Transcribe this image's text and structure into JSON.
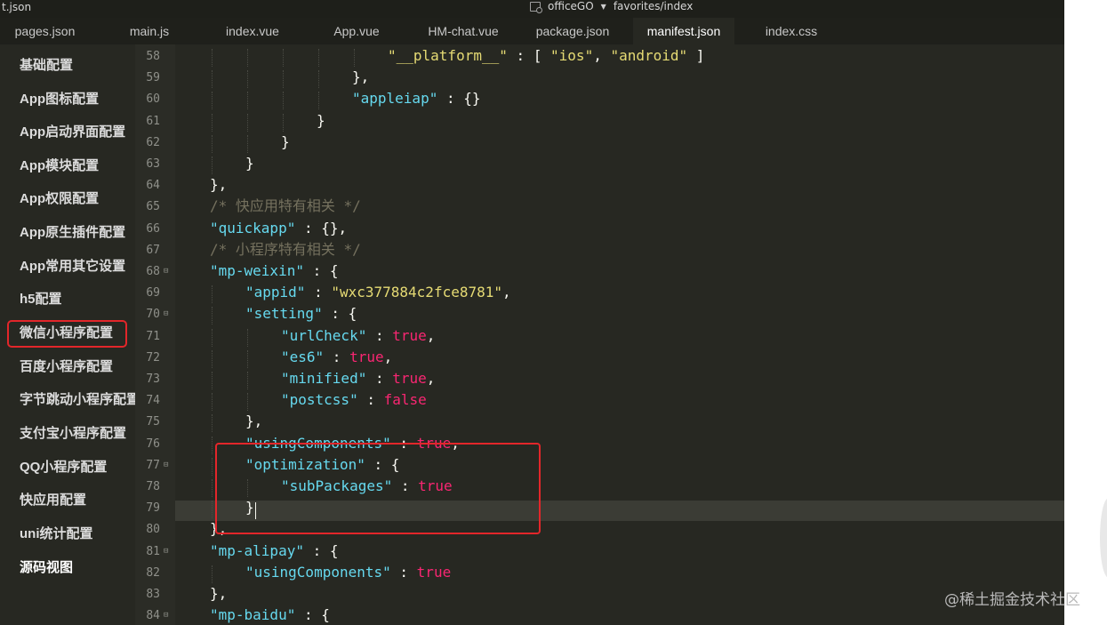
{
  "topbar": {
    "file_name": "t.json",
    "project": "officeGO",
    "path": "favorites/index"
  },
  "tabs": [
    {
      "label": "pages.json"
    },
    {
      "label": "main.js"
    },
    {
      "label": "index.vue"
    },
    {
      "label": "App.vue"
    },
    {
      "label": "HM-chat.vue"
    },
    {
      "label": "package.json"
    },
    {
      "label": "manifest.json",
      "active": true
    },
    {
      "label": "index.css"
    }
  ],
  "sidebar": {
    "items": [
      {
        "label": "基础配置"
      },
      {
        "label": "App图标配置"
      },
      {
        "label": "App启动界面配置"
      },
      {
        "label": "App模块配置"
      },
      {
        "label": "App权限配置"
      },
      {
        "label": "App原生插件配置"
      },
      {
        "label": "App常用其它设置"
      },
      {
        "label": "h5配置"
      },
      {
        "label": "微信小程序配置",
        "highlighted": true
      },
      {
        "label": "百度小程序配置"
      },
      {
        "label": "字节跳动小程序配置"
      },
      {
        "label": "支付宝小程序配置"
      },
      {
        "label": "QQ小程序配置"
      },
      {
        "label": "快应用配置"
      },
      {
        "label": "uni统计配置"
      },
      {
        "label": "源码视图"
      }
    ]
  },
  "code": {
    "lines": [
      {
        "n": "58",
        "fold": false,
        "t": [
          [
            "s",
            "\"__platform__\""
          ],
          [
            "p",
            " : [ "
          ],
          [
            "s",
            "\"ios\""
          ],
          [
            "p",
            ", "
          ],
          [
            "s",
            "\"android\""
          ],
          [
            "p",
            " ]"
          ]
        ],
        "indent": 6
      },
      {
        "n": "59",
        "fold": false,
        "t": [
          [
            "p",
            "},"
          ]
        ],
        "indent": 5
      },
      {
        "n": "60",
        "fold": false,
        "t": [
          [
            "k",
            "\"appleiap\""
          ],
          [
            "p",
            " : {}"
          ]
        ],
        "indent": 5
      },
      {
        "n": "61",
        "fold": false,
        "t": [
          [
            "p",
            "}"
          ]
        ],
        "indent": 4
      },
      {
        "n": "62",
        "fold": false,
        "t": [
          [
            "p",
            "}"
          ]
        ],
        "indent": 3
      },
      {
        "n": "63",
        "fold": false,
        "t": [
          [
            "p",
            "}"
          ]
        ],
        "indent": 2
      },
      {
        "n": "64",
        "fold": false,
        "t": [
          [
            "p",
            "},"
          ]
        ],
        "indent": 1
      },
      {
        "n": "65",
        "fold": false,
        "t": [
          [
            "c",
            "/* 快应用特有相关 */"
          ]
        ],
        "indent": 1
      },
      {
        "n": "66",
        "fold": false,
        "t": [
          [
            "k",
            "\"quickapp\""
          ],
          [
            "p",
            " : {},"
          ]
        ],
        "indent": 1
      },
      {
        "n": "67",
        "fold": false,
        "t": [
          [
            "c",
            "/* 小程序特有相关 */"
          ]
        ],
        "indent": 1
      },
      {
        "n": "68",
        "fold": true,
        "t": [
          [
            "k",
            "\"mp-weixin\""
          ],
          [
            "p",
            " : {"
          ]
        ],
        "indent": 1
      },
      {
        "n": "69",
        "fold": false,
        "t": [
          [
            "k",
            "\"appid\""
          ],
          [
            "p",
            " : "
          ],
          [
            "s",
            "\"wxc377884c2fce8781\""
          ],
          [
            "p",
            ","
          ]
        ],
        "indent": 2
      },
      {
        "n": "70",
        "fold": true,
        "t": [
          [
            "k",
            "\"setting\""
          ],
          [
            "p",
            " : {"
          ]
        ],
        "indent": 2
      },
      {
        "n": "71",
        "fold": false,
        "t": [
          [
            "k",
            "\"urlCheck\""
          ],
          [
            "p",
            " : "
          ],
          [
            "b",
            "true"
          ],
          [
            "p",
            ","
          ]
        ],
        "indent": 3
      },
      {
        "n": "72",
        "fold": false,
        "t": [
          [
            "k",
            "\"es6\""
          ],
          [
            "p",
            " : "
          ],
          [
            "b",
            "true"
          ],
          [
            "p",
            ","
          ]
        ],
        "indent": 3
      },
      {
        "n": "73",
        "fold": false,
        "t": [
          [
            "k",
            "\"minified\""
          ],
          [
            "p",
            " : "
          ],
          [
            "b",
            "true"
          ],
          [
            "p",
            ","
          ]
        ],
        "indent": 3
      },
      {
        "n": "74",
        "fold": false,
        "t": [
          [
            "k",
            "\"postcss\""
          ],
          [
            "p",
            " : "
          ],
          [
            "b",
            "false"
          ]
        ],
        "indent": 3
      },
      {
        "n": "75",
        "fold": false,
        "t": [
          [
            "p",
            "},"
          ]
        ],
        "indent": 2
      },
      {
        "n": "76",
        "fold": false,
        "t": [
          [
            "k",
            "\"usingComponents\""
          ],
          [
            "p",
            " : "
          ],
          [
            "b",
            "true"
          ],
          [
            "p",
            ","
          ]
        ],
        "indent": 2
      },
      {
        "n": "77",
        "fold": true,
        "t": [
          [
            "k",
            "\"optimization\""
          ],
          [
            "p",
            " : {"
          ]
        ],
        "indent": 2
      },
      {
        "n": "78",
        "fold": false,
        "t": [
          [
            "k",
            "\"subPackages\""
          ],
          [
            "p",
            " : "
          ],
          [
            "b",
            "true"
          ]
        ],
        "indent": 3
      },
      {
        "n": "79",
        "fold": false,
        "t": [
          [
            "p",
            "}"
          ]
        ],
        "indent": 2
      },
      {
        "n": "80",
        "fold": false,
        "t": [
          [
            "p",
            "},"
          ]
        ],
        "indent": 1
      },
      {
        "n": "81",
        "fold": true,
        "t": [
          [
            "k",
            "\"mp-alipay\""
          ],
          [
            "p",
            " : {"
          ]
        ],
        "indent": 1
      },
      {
        "n": "82",
        "fold": false,
        "t": [
          [
            "k",
            "\"usingComponents\""
          ],
          [
            "p",
            " : "
          ],
          [
            "b",
            "true"
          ]
        ],
        "indent": 2
      },
      {
        "n": "83",
        "fold": false,
        "t": [
          [
            "p",
            "},"
          ]
        ],
        "indent": 1
      },
      {
        "n": "84",
        "fold": true,
        "t": [
          [
            "k",
            "\"mp-baidu\""
          ],
          [
            "p",
            " : {"
          ]
        ],
        "indent": 1
      }
    ]
  },
  "watermark": "@稀土掘金技术社区",
  "colors": {
    "editor_bg": "#272822",
    "string": "#e6db74",
    "key": "#66d9ef",
    "boolean": "#f92672",
    "comment": "#75715e",
    "highlight_box": "#e3262a"
  }
}
